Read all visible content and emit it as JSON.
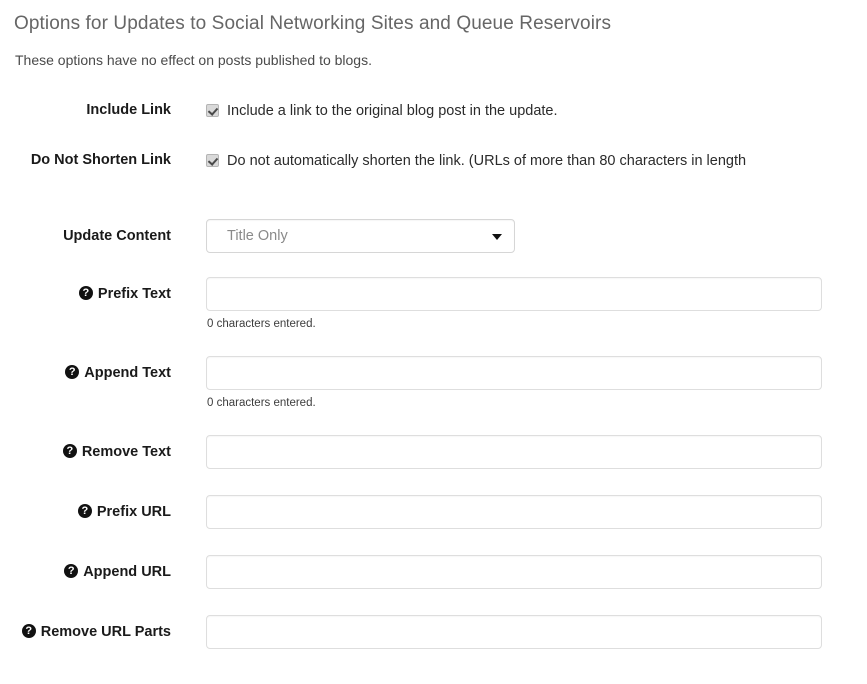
{
  "section": {
    "heading": "Options for Updates to Social Networking Sites and Queue Reservoirs",
    "subtitle": "These options have no effect on posts published to blogs."
  },
  "icons": {
    "help": "?",
    "help_name": "help-icon",
    "dropdown_arrow": "dropdown-arrow-icon"
  },
  "rows": {
    "include_link": {
      "label": "Include Link",
      "checkbox_label": "Include a link to the original blog post in the update.",
      "checked": true
    },
    "do_not_shorten_link": {
      "label": "Do Not Shorten Link",
      "checkbox_label": "Do not automatically shorten the link. (URLs of more than 80 characters in length",
      "checked": true
    },
    "update_content": {
      "label": "Update Content",
      "selected": "Title Only"
    },
    "prefix_text": {
      "label": "Prefix Text",
      "value": "",
      "hint": "0 characters entered."
    },
    "append_text": {
      "label": "Append Text",
      "value": "",
      "hint": "0 characters entered."
    },
    "remove_text": {
      "label": "Remove Text",
      "value": ""
    },
    "prefix_url": {
      "label": "Prefix URL",
      "value": ""
    },
    "append_url": {
      "label": "Append URL",
      "value": ""
    },
    "remove_url_parts": {
      "label": "Remove URL Parts",
      "value": ""
    }
  }
}
